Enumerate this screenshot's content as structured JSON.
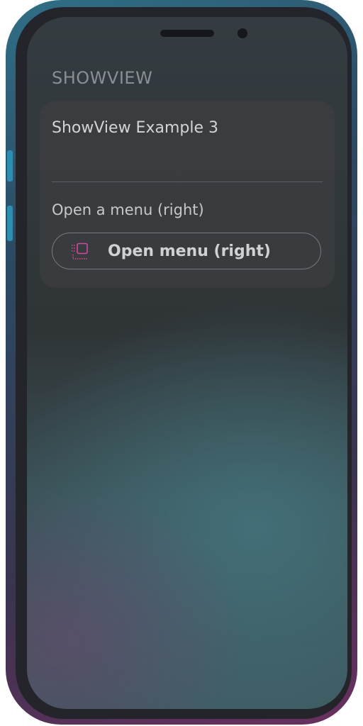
{
  "app": {
    "section_header": "SHOWVIEW"
  },
  "card": {
    "title": "ShowView Example 3",
    "row_label": "Open a menu (right)",
    "button_label": "Open menu (right)",
    "button_icon": "sidebar-right-icon"
  },
  "colors": {
    "accent_icon": "#d04a9a",
    "frame_left": "#2b8fb2",
    "frame_right": "#6b2f5f"
  }
}
